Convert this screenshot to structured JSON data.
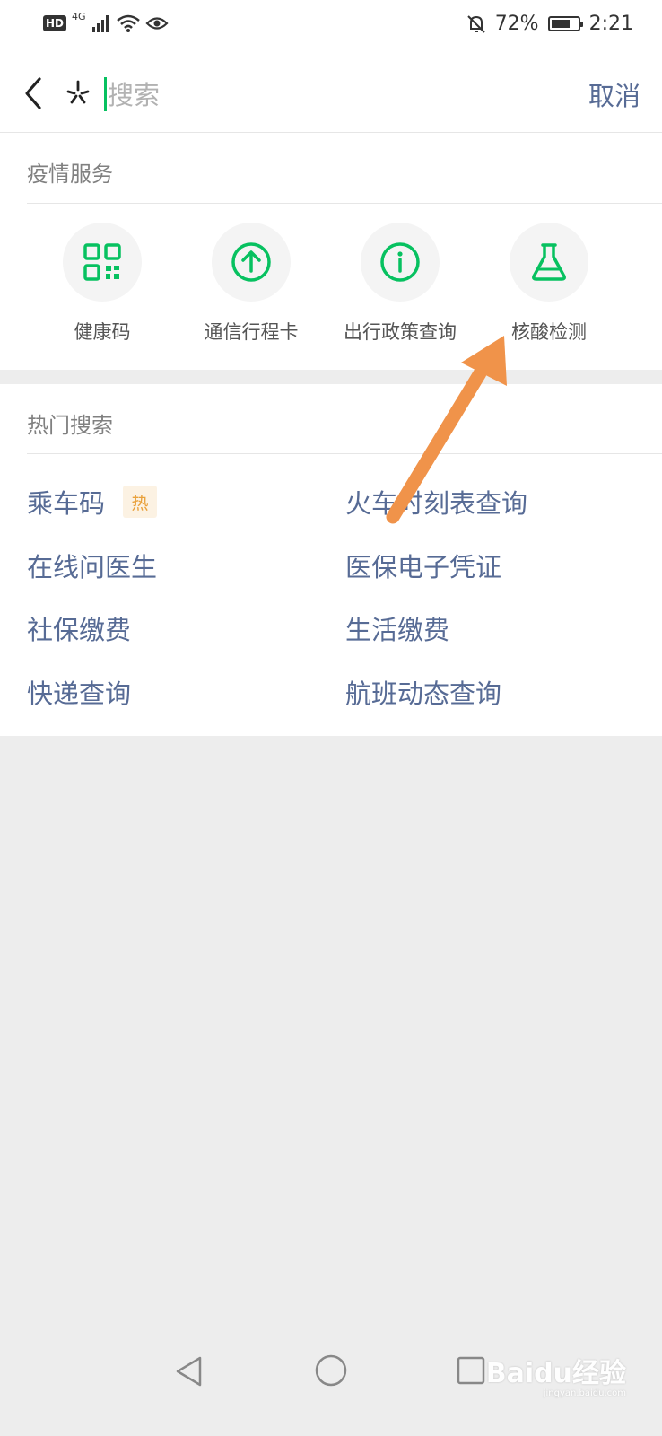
{
  "status_bar": {
    "hd": "HD",
    "network": "4G",
    "battery_percent": "72%",
    "battery_level": 0.72,
    "time": "2:21"
  },
  "search": {
    "placeholder": "搜索",
    "value": "",
    "cancel_label": "取消"
  },
  "epidemic_services": {
    "title": "疫情服务",
    "items": [
      {
        "label": "健康码",
        "icon": "qr-code-icon"
      },
      {
        "label": "通信行程卡",
        "icon": "arrow-up-circle-icon"
      },
      {
        "label": "出行政策查询",
        "icon": "info-circle-icon"
      },
      {
        "label": "核酸检测",
        "icon": "flask-icon"
      }
    ]
  },
  "hot_search": {
    "title": "热门搜索",
    "hot_badge": "热",
    "items": [
      "乘车码",
      "火车时刻表查询",
      "在线问医生",
      "医保电子凭证",
      "社保缴费",
      "生活缴费",
      "快递查询",
      "航班动态查询"
    ]
  },
  "watermark": {
    "brand": "Baidu经验",
    "url": "jingyan.baidu.com"
  },
  "colors": {
    "accent_green": "#07c160",
    "link_blue": "#576b95",
    "annotation_arrow": "#f0934a",
    "background": "#ededed"
  }
}
